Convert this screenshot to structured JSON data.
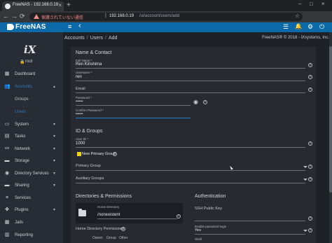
{
  "browser": {
    "tab_title": "FreeNAS - 192.168.0.19",
    "tab_close": "×",
    "new_tab": "+",
    "window_controls": {
      "min": "–",
      "max": "□",
      "close": "×"
    },
    "nav": {
      "back": "←",
      "forward": "→",
      "reload": "⟳"
    },
    "url_not_secure": "保護されていない通信",
    "url_separator": "|",
    "url_host": "192.168.0.19",
    "url_path": "/ui/account/users/add",
    "bookmark": "☆"
  },
  "appbar": {
    "logo": "FreeNAS",
    "menu_icon": "≡",
    "back_icon": "‹",
    "icons": {
      "list": "☰",
      "bell": "🔔",
      "gear": "⚙",
      "power": "⏻"
    }
  },
  "sidebar": {
    "logo": "iX",
    "lock": "🔒",
    "user": "root",
    "items": [
      {
        "label": "Dashboard",
        "icon": "▦"
      },
      {
        "label": "Accounts",
        "icon": "👥",
        "chevron": "▴"
      },
      {
        "label": "Groups",
        "icon": ""
      },
      {
        "label": "Users",
        "icon": ""
      },
      {
        "label": "System",
        "icon": "▭",
        "chevron": "▾"
      },
      {
        "label": "Tasks",
        "icon": "▤",
        "chevron": "▾"
      },
      {
        "label": "Network",
        "icon": "⚯",
        "chevron": "▾"
      },
      {
        "label": "Storage",
        "icon": "▬",
        "chevron": "▾"
      },
      {
        "label": "Directory Services",
        "icon": "◉",
        "chevron": "▾"
      },
      {
        "label": "Sharing",
        "icon": "▬",
        "chevron": "▾"
      },
      {
        "label": "Services",
        "icon": "≡"
      },
      {
        "label": "Plugins",
        "icon": "✤",
        "chevron": "▾"
      },
      {
        "label": "Jails",
        "icon": "▦"
      },
      {
        "label": "Reporting",
        "icon": "▥"
      }
    ]
  },
  "breadcrumb": {
    "parts": [
      "Accounts",
      "Users",
      "Add"
    ],
    "sep": "/"
  },
  "copyright": "FreeNAS® © 2018 - iXsystems, Inc.",
  "form": {
    "section_name_contact": "Name & Contact",
    "full_name": {
      "label": "Full Name *",
      "value": "Ren Kirishima"
    },
    "username": {
      "label": "Username *",
      "value": "ren"
    },
    "email": {
      "label": "Email",
      "value": ""
    },
    "password": {
      "label": "Password *",
      "value": "••••••"
    },
    "confirm_password": {
      "label": "Confirm Password *",
      "value": "••••••"
    },
    "section_id_groups": "ID & Groups",
    "user_id": {
      "label": "User ID *",
      "value": "1000"
    },
    "new_primary_group": "New Primary Group",
    "primary_group": "Primary Group",
    "auxiliary_groups": "Auxiliary Groups",
    "section_directories": "Directories & Permissions",
    "home_directory": {
      "label": "Home Directory",
      "value": "/nonexistent"
    },
    "home_dir_permissions": "Home Directory Permissions",
    "perm_columns": [
      "Owner",
      "Group",
      "Other"
    ],
    "section_auth": "Authentication",
    "ssh_public_key": "SSH Public Key",
    "enable_password_login": {
      "label": "Enable password login",
      "value": "Yes"
    },
    "shell": "Shell",
    "help_glyph": "?",
    "eye_glyph": "◉"
  },
  "colors": {
    "accent": "#0d6aa8",
    "sidebar": "#282c34",
    "card": "#272b31",
    "checkbox": "#e8d51c"
  }
}
